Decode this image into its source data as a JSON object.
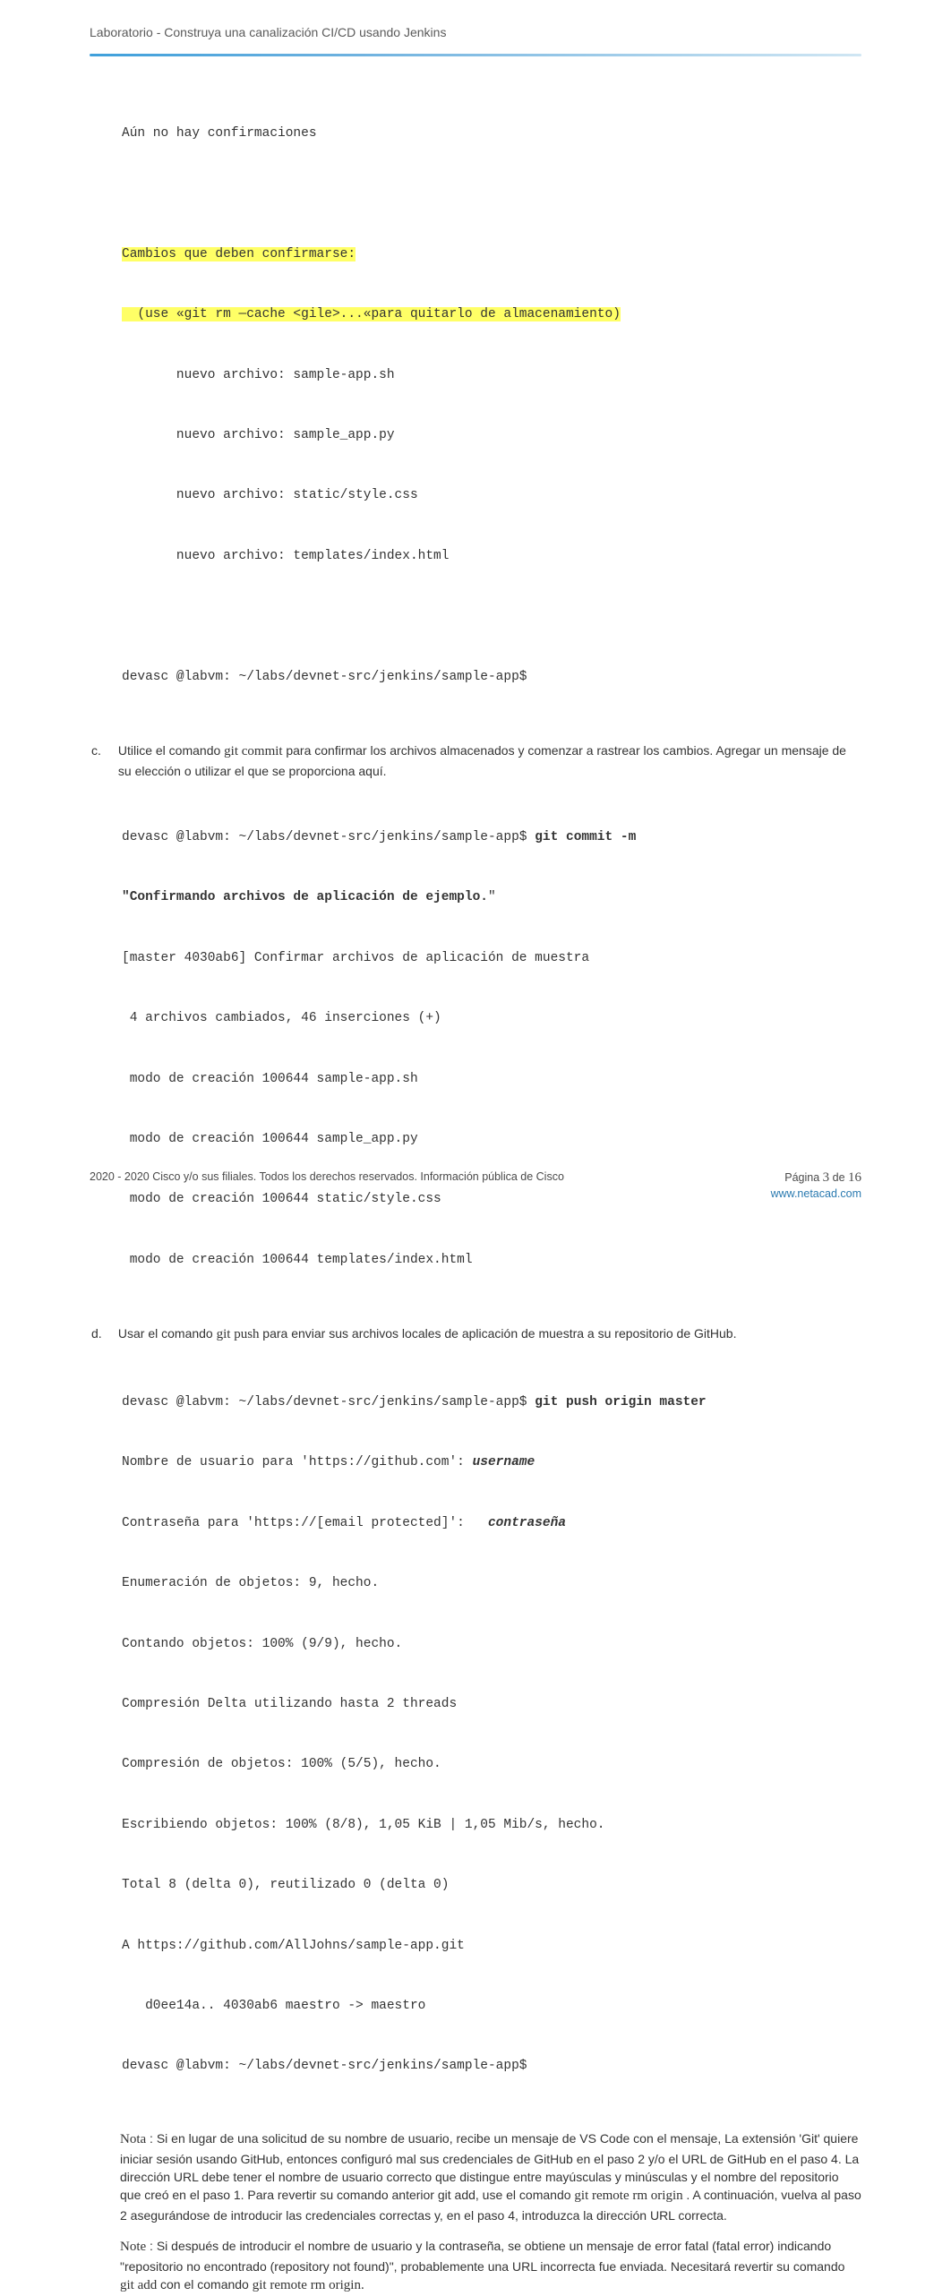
{
  "header": "Laboratorio - Construya una canalización CI/CD usando Jenkins",
  "block1": {
    "l1": "Aún no hay confirmaciones",
    "l2": "Cambios que deben confirmarse:",
    "l3": "  (use «git rm —cache <gile>...«para quitarlo de almacenamiento)",
    "l4": "       nuevo archivo: sample-app.sh",
    "l5": "       nuevo archivo: sample_app.py",
    "l6": "       nuevo archivo: static/style.css",
    "l7": "       nuevo archivo: templates/index.html",
    "l8": "devasc @labvm: ~/labs/devnet-src/jenkins/sample-app$"
  },
  "step_c": {
    "label": "c.",
    "text_pre": "Utilice el comando ",
    "cmd": "git commit ",
    "text_post": " para confirmar los archivos almacenados y comenzar a rastrear los cambios. Agregar un mensaje de su elección o utilizar el que se proporciona aquí."
  },
  "block2": {
    "l1a": "devasc @labvm: ~/labs/devnet-src/jenkins/sample-app$ ",
    "l1b": "git commit -m ",
    "l2a": "\"Confirmando archivos de aplicación de ejemplo.",
    "l2b": "\"",
    "l3": "[master 4030ab6] Confirmar archivos de aplicación de muestra",
    "l4": " 4 archivos cambiados, 46 inserciones (+)",
    "l5": " modo de creación 100644 sample-app.sh",
    "l6": " modo de creación 100644 sample_app.py",
    "l7": " modo de creación 100644 static/style.css",
    "l8": " modo de creación 100644 templates/index.html"
  },
  "step_d": {
    "label": "d.",
    "text_pre": "Usar el comando ",
    "cmd": "git push ",
    "text_post": " para enviar sus archivos locales de aplicación de muestra a su repositorio de GitHub."
  },
  "block3": {
    "l1a": "devasc @labvm: ~/labs/devnet-src/jenkins/sample-app$ ",
    "l1b": "git push origin master",
    "l2a": "Nombre de usuario para 'https://github.com': ",
    "l2b": "username",
    "l3a": "Contraseña para 'https://[email protected]':   ",
    "l3b": "contraseña",
    "l4": "Enumeración de objetos: 9, hecho.",
    "l5": "Contando objetos: 100% (9/9), hecho.",
    "l6": "Compresión Delta utilizando hasta 2 threads",
    "l7": "Compresión de objetos: 100% (5/5), hecho.",
    "l8": "Escribiendo objetos: 100% (8/8), 1,05 KiB | 1,05 Mib/s, hecho.",
    "l9": "Total 8 (delta 0), reutilizado 0 (delta 0)",
    "l10": "A https://github.com/AllJohns/sample-app.git",
    "l11": "   d0ee14a.. 4030ab6 maestro -> maestro",
    "l12": "devasc @labvm: ~/labs/devnet-src/jenkins/sample-app$"
  },
  "note1": {
    "head": "Nota",
    "sep": " : ",
    "p1": "Si en lugar de una solicitud de su nombre de usuario, recibe un mensaje de VS Code con el mensaje, La extensión 'Git' quiere iniciar sesión usando GitHub, entonces configuró mal sus credenciales de GitHub en el paso 2 y/o el URL de GitHub en el paso 4. La dirección URL debe tener el nombre de usuario correcto que distingue entre mayúsculas y minúsculas y el nombre del repositorio que creó en el paso 1. Para revertir su comando anterior git add, use el comando ",
    "cmd": "git remote rm origin   ",
    "p2": ". A continuación, vuelva al paso 2 asegurándose de introducir las credenciales correctas y, en el paso 4, introduzca la dirección URL correcta."
  },
  "note2": {
    "head": "Note",
    "sep": " : ",
    "p1": "Si después de introducir el nombre de usuario y la contraseña, se obtiene un mensaje de error fatal (fatal error) indicando \"repositorio no encontrado (repository not found)\", probablemente una URL incorrecta fue enviada. Necesitará revertir su comando ",
    "cmd1": "git add ",
    "p2": " con el comando ",
    "cmd2": "git remote rm origin."
  },
  "footer": {
    "left_icon": "",
    "left_text": " 2020 - 2020 Cisco y/o sus filiales. Todos los derechos reservados. Información pública de Cisco",
    "right_pre": "Página ",
    "page": "3",
    "right_mid": " de ",
    "total": "16",
    "url": "www.netacad.com"
  }
}
